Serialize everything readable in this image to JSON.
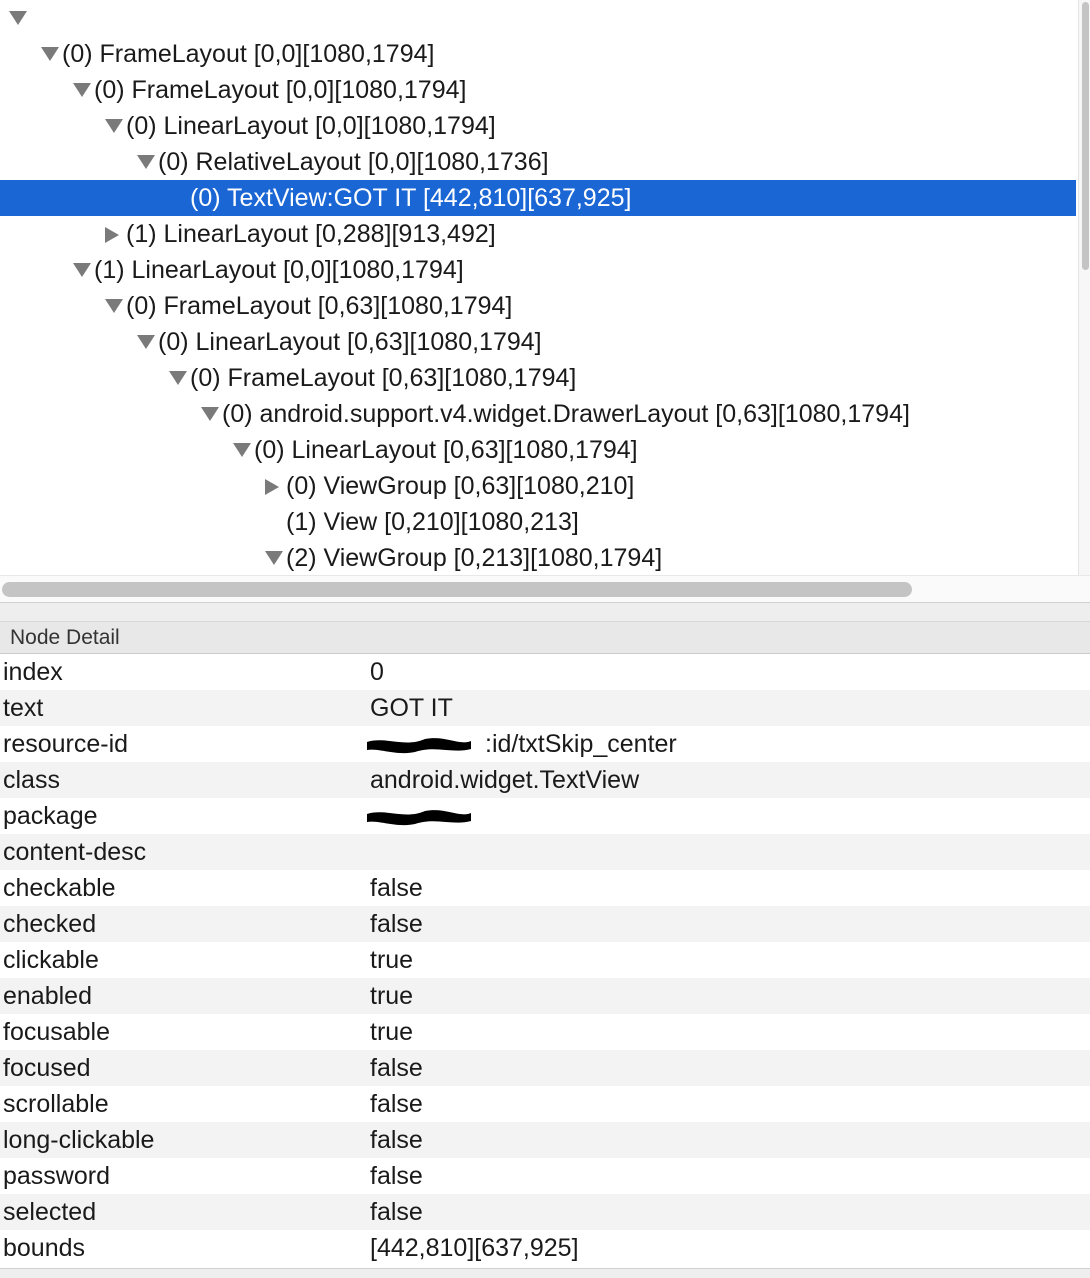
{
  "tree": {
    "nodes": [
      {
        "text": "",
        "depth": 0,
        "toggle": "expanded",
        "selected": false
      },
      {
        "text": "(0) FrameLayout [0,0][1080,1794]",
        "depth": 1,
        "toggle": "expanded",
        "selected": false
      },
      {
        "text": "(0) FrameLayout [0,0][1080,1794]",
        "depth": 2,
        "toggle": "expanded",
        "selected": false
      },
      {
        "text": "(0) LinearLayout [0,0][1080,1794]",
        "depth": 3,
        "toggle": "expanded",
        "selected": false
      },
      {
        "text": "(0) RelativeLayout [0,0][1080,1736]",
        "depth": 4,
        "toggle": "expanded",
        "selected": false
      },
      {
        "text": "(0) TextView:GOT IT [442,810][637,925]",
        "depth": 5,
        "toggle": "none",
        "selected": true
      },
      {
        "text": "(1) LinearLayout [0,288][913,492]",
        "depth": 3,
        "toggle": "collapsed",
        "selected": false
      },
      {
        "text": "(1) LinearLayout [0,0][1080,1794]",
        "depth": 2,
        "toggle": "expanded",
        "selected": false
      },
      {
        "text": "(0) FrameLayout [0,63][1080,1794]",
        "depth": 3,
        "toggle": "expanded",
        "selected": false
      },
      {
        "text": "(0) LinearLayout [0,63][1080,1794]",
        "depth": 4,
        "toggle": "expanded",
        "selected": false
      },
      {
        "text": "(0) FrameLayout [0,63][1080,1794]",
        "depth": 5,
        "toggle": "expanded",
        "selected": false
      },
      {
        "text": "(0) android.support.v4.widget.DrawerLayout [0,63][1080,1794]",
        "depth": 6,
        "toggle": "expanded",
        "selected": false
      },
      {
        "text": "(0) LinearLayout [0,63][1080,1794]",
        "depth": 7,
        "toggle": "expanded",
        "selected": false
      },
      {
        "text": "(0) ViewGroup [0,63][1080,210]",
        "depth": 8,
        "toggle": "collapsed",
        "selected": false
      },
      {
        "text": "(1) View [0,210][1080,213]",
        "depth": 8,
        "toggle": "none",
        "selected": false
      },
      {
        "text": "(2) ViewGroup [0,213][1080,1794]",
        "depth": 8,
        "toggle": "expanded",
        "selected": false
      }
    ]
  },
  "detail": {
    "title": "Node Detail",
    "rows": [
      {
        "key": "index",
        "value": "0"
      },
      {
        "key": "text",
        "value": "GOT IT"
      },
      {
        "key": "resource-id",
        "value": ":id/txtSkip_center",
        "redacted_prefix": true
      },
      {
        "key": "class",
        "value": "android.widget.TextView"
      },
      {
        "key": "package",
        "value": "",
        "redacted": true
      },
      {
        "key": "content-desc",
        "value": ""
      },
      {
        "key": "checkable",
        "value": "false"
      },
      {
        "key": "checked",
        "value": "false"
      },
      {
        "key": "clickable",
        "value": "true"
      },
      {
        "key": "enabled",
        "value": "true"
      },
      {
        "key": "focusable",
        "value": "true"
      },
      {
        "key": "focused",
        "value": "false"
      },
      {
        "key": "scrollable",
        "value": "false"
      },
      {
        "key": "long-clickable",
        "value": "false"
      },
      {
        "key": "password",
        "value": "false"
      },
      {
        "key": "selected",
        "value": "false"
      },
      {
        "key": "bounds",
        "value": "[442,810][637,925]"
      }
    ]
  },
  "colors": {
    "selection": "#1a66d4",
    "alt_row": "#f3f3f3",
    "toggle": "#7a7a7a"
  },
  "icons": {
    "expanded": "triangle-down-icon",
    "collapsed": "triangle-right-icon"
  }
}
